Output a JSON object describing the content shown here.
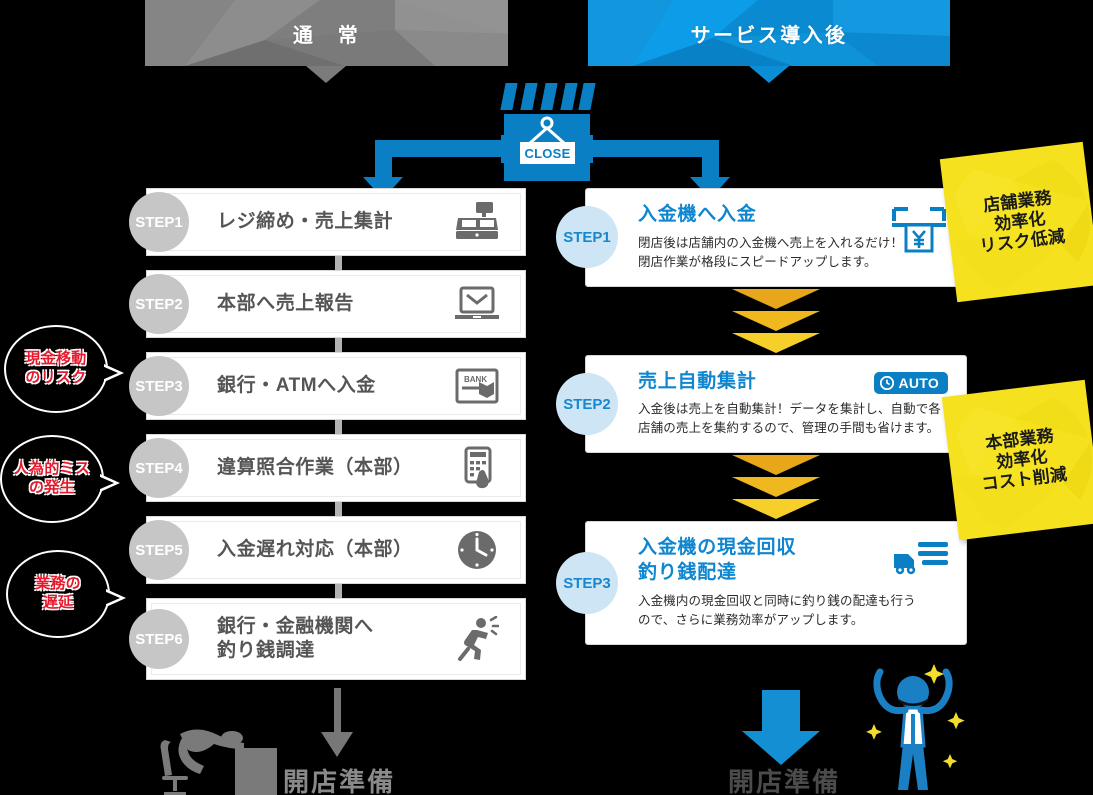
{
  "headers": {
    "left": {
      "label": "通　常",
      "color": "#7b7b7b"
    },
    "right": {
      "label": "サービス導入後",
      "color": "#0b8ed6"
    }
  },
  "shop_sign": {
    "label": "CLOSE",
    "icon": "shop-awning-icon",
    "color": "#0b7fc4"
  },
  "left_flow": {
    "steps": [
      {
        "step": "STEP1",
        "title": "レジ締め・売上集計",
        "icon": "cash-register-icon"
      },
      {
        "step": "STEP2",
        "title": "本部へ売上報告",
        "icon": "laptop-mail-icon"
      },
      {
        "step": "STEP3",
        "title": "銀行・ATMへ入金",
        "icon": "bank-deposit-icon"
      },
      {
        "step": "STEP4",
        "title": "違算照合作業（本部）",
        "icon": "calculator-icon"
      },
      {
        "step": "STEP5",
        "title": "入金遅れ対応（本部）",
        "icon": "clock-icon"
      },
      {
        "step": "STEP6",
        "title": "銀行・金融機関へ\n釣り銭調達",
        "title_line1": "銀行・金融機関へ",
        "title_line2": "釣り銭調達",
        "icon": "running-person-icon"
      }
    ],
    "circle_color": "#c6c6c6",
    "text_color": "#555555"
  },
  "risk_bubbles": [
    {
      "line1": "現金移動",
      "line2": "のリスク",
      "color": "#e8192c"
    },
    {
      "line1": "人為的ミス",
      "line2": "の発生",
      "color": "#e8192c"
    },
    {
      "line1": "業務の",
      "line2": "遅延",
      "color": "#e8192c"
    }
  ],
  "right_flow": {
    "steps": [
      {
        "step": "STEP1",
        "title": "入金機へ入金",
        "desc_line1": "閉店後は店舗内の入金機へ売上を入れるだけ！",
        "desc_line2": "閉店作業が格段にスピードアップします。",
        "icon": "deposit-machine-yen-icon"
      },
      {
        "step": "STEP2",
        "title": "売上自動集計",
        "desc_line1": "入金後は売上を自動集計！データを集計し、自動で各",
        "desc_line2": "店舗の売上を集約するので、管理の手間も省けます。",
        "icon": "auto-badge-icon",
        "badge": "AUTO"
      },
      {
        "step": "STEP3",
        "title_line1": "入金機の現金回収",
        "title_line2": "釣り銭配達",
        "title": "入金機の現金回収 釣り銭配達",
        "desc_line1": "入金機内の現金回収と同時に釣り銭の配達も行う",
        "desc_line2": "ので、さらに業務効率がアップします。",
        "icon": "delivery-truck-icon"
      }
    ],
    "circle_color": "#cde5f5",
    "title_color": "#0e86d0"
  },
  "seals": [
    {
      "line1": "店舗業務",
      "line2": "効率化",
      "line3": "リスク低減",
      "color": "#f5e11e"
    },
    {
      "line1": "本部業務",
      "line2": "効率化",
      "line3": "コスト削減",
      "color": "#f5e11e"
    }
  ],
  "footer": {
    "left": {
      "label": "開店準備",
      "icon": "exhausted-person-icon",
      "arrow_color": "#777777"
    },
    "right": {
      "label": "開店準備",
      "icon": "cheering-person-icon",
      "arrow_color": "#158fd4"
    }
  }
}
